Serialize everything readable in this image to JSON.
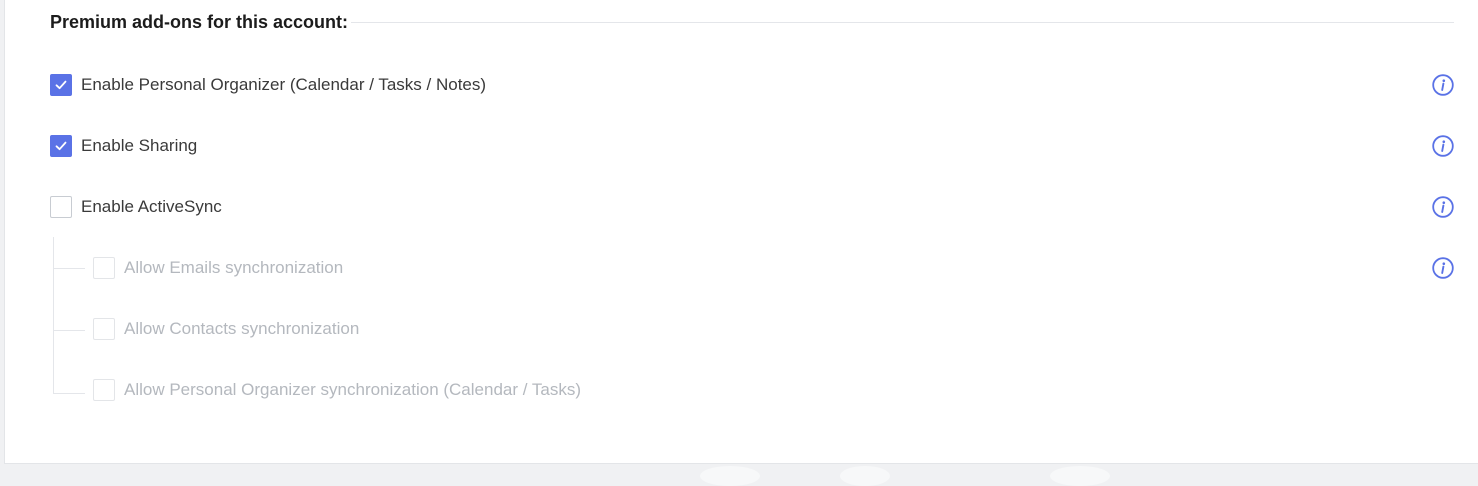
{
  "section": {
    "title": "Premium add-ons for this account:"
  },
  "addons": [
    {
      "label": "Enable Personal Organizer (Calendar / Tasks / Notes)",
      "checked": true
    },
    {
      "label": "Enable Sharing",
      "checked": true
    },
    {
      "label": "Enable ActiveSync",
      "checked": false
    }
  ],
  "activesync_options": [
    {
      "label": "Allow Emails synchronization",
      "checked": false,
      "disabled": true
    },
    {
      "label": "Allow Contacts synchronization",
      "checked": false,
      "disabled": true
    },
    {
      "label": "Allow Personal Organizer synchronization (Calendar / Tasks)",
      "checked": false,
      "disabled": true
    }
  ],
  "icons": {
    "check": "check-icon",
    "info": "info-icon"
  },
  "colors": {
    "accent": "#5a72e6",
    "text": "#3a3a3a",
    "text_disabled": "#b4b8be",
    "title": "#1c1c1c",
    "info_icon": "#5a72e6"
  }
}
